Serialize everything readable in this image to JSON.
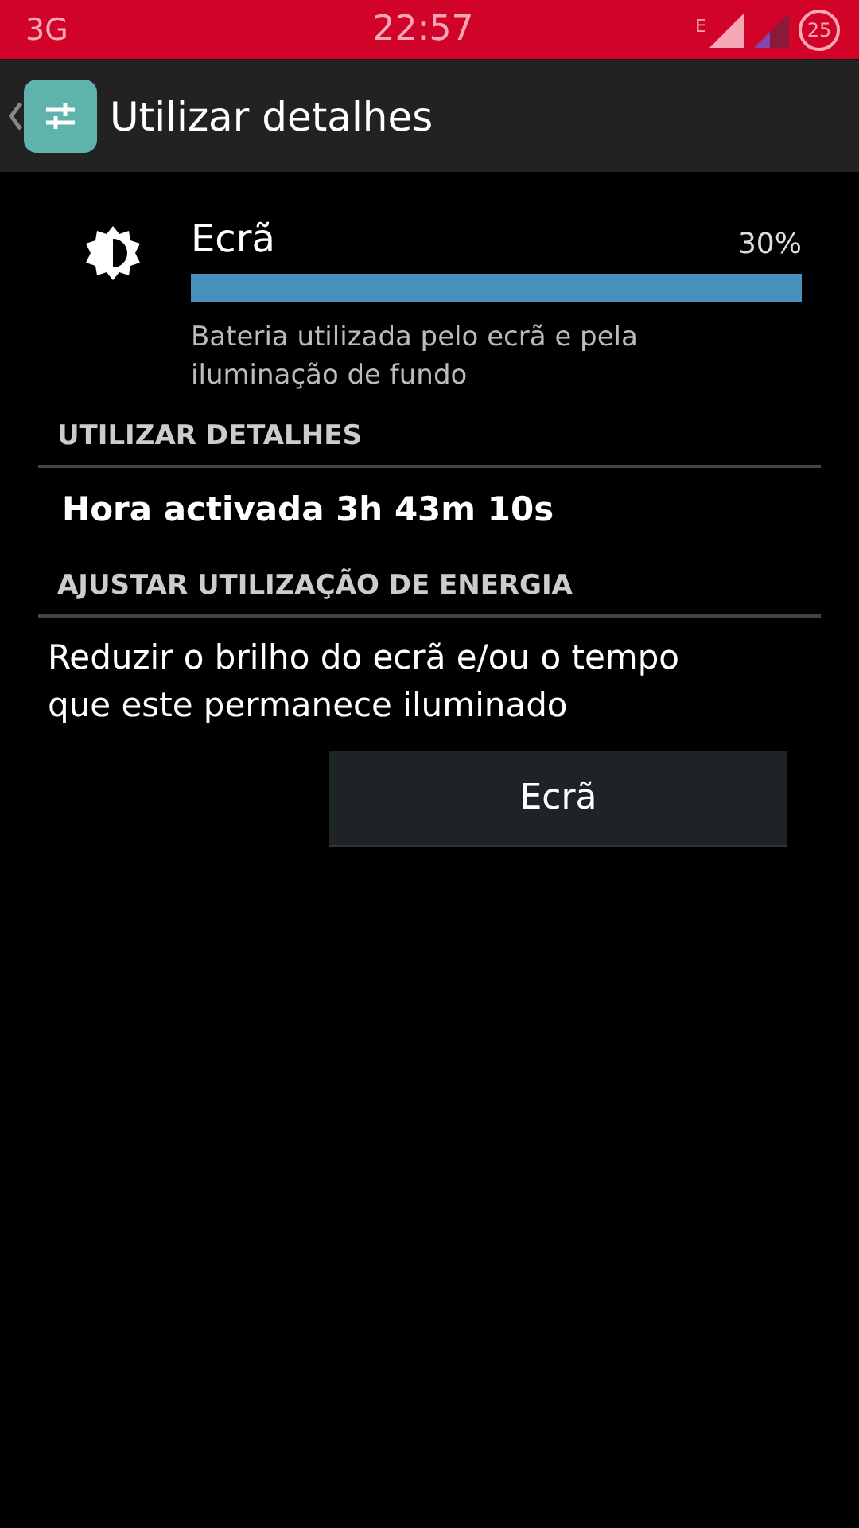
{
  "status_bar": {
    "network": "3G",
    "time": "22:57",
    "signal_label": "E",
    "battery": "25"
  },
  "action_bar": {
    "title": "Utilizar detalhes"
  },
  "usage": {
    "name": "Ecrã",
    "percent": "30%",
    "description": "Bateria utilizada pelo ecrã e pela iluminação de fundo"
  },
  "sections": [
    {
      "header": "UTILIZAR DETALHES",
      "kind": "detail",
      "text": "Hora activada 3h 43m 10s"
    },
    {
      "header": "AJUSTAR UTILIZAÇÃO DE ENERGIA",
      "kind": "action",
      "text": "Reduzir o brilho do ecrã e/ou o tempo que este permanece iluminado",
      "button": "Ecrã"
    }
  ]
}
